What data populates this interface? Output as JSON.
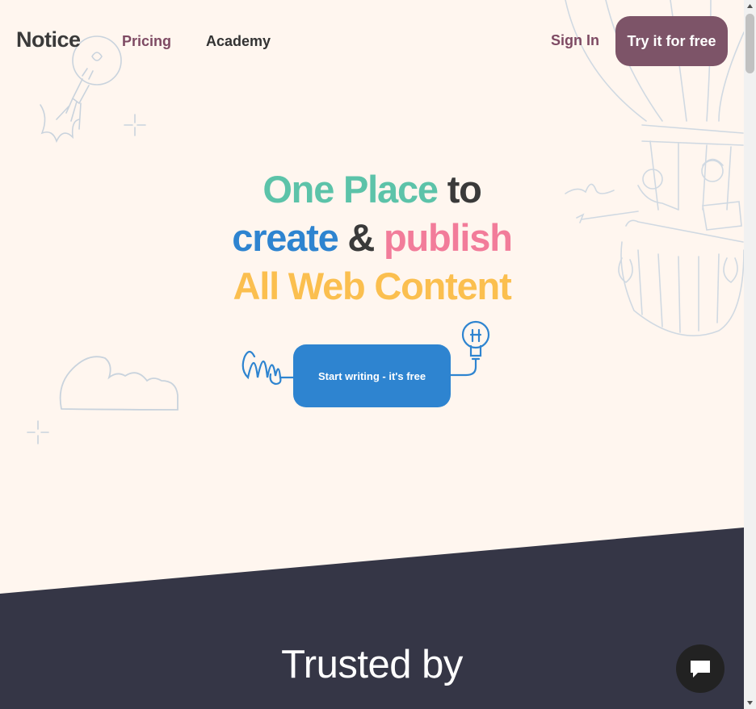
{
  "header": {
    "logo": "Notice",
    "nav": {
      "pricing": "Pricing",
      "academy": "Academy",
      "sign_in": "Sign In"
    },
    "try_button": "Try it for free"
  },
  "hero": {
    "line1_a": "One Place",
    "line1_b": "to",
    "line2_a": "create",
    "line2_b": "&",
    "line2_c": "publish",
    "line3": "All Web Content",
    "cta": "Start writing - it's free"
  },
  "trusted": {
    "heading": "Trusted by"
  },
  "colors": {
    "background": "#fff6ef",
    "dark_band": "#353646",
    "brand_purple": "#7d5468",
    "teal": "#5cc3a9",
    "blue": "#2e84d0",
    "pink": "#f27c9a",
    "yellow": "#fbbf4f"
  },
  "icons": {
    "chat": "chat-bubble-icon",
    "rocket_bulb": "rocket-lightbulb-icon",
    "balloon": "hot-air-balloon-icon",
    "cloud": "cloud-icon",
    "sparkle": "sparkle-icon",
    "spring": "spring-icon",
    "bulb": "lightbulb-icon"
  }
}
